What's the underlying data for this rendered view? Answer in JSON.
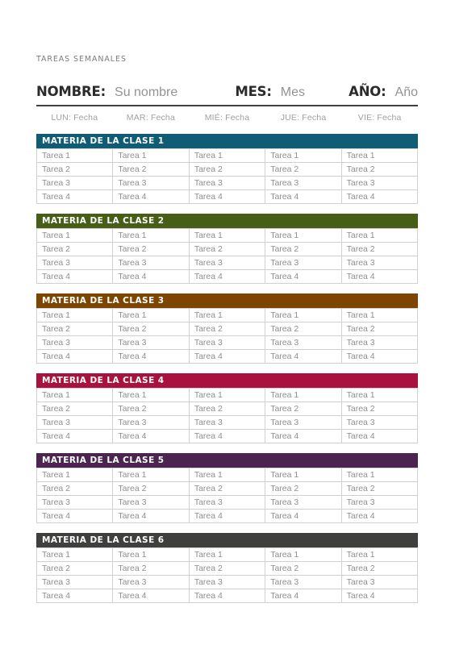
{
  "document": {
    "title": "TAREAS SEMANALES"
  },
  "identity": {
    "name_label": "NOMBRE:",
    "name_value": "Su nombre",
    "month_label": "MES:",
    "month_value": "Mes",
    "year_label": "AÑO:",
    "year_value": "Año"
  },
  "days": [
    {
      "abbr": "LUN:",
      "value": "Fecha"
    },
    {
      "abbr": "MAR:",
      "value": "Fecha"
    },
    {
      "abbr": "MIÉ:",
      "value": "Fecha"
    },
    {
      "abbr": "JUE:",
      "value": "Fecha"
    },
    {
      "abbr": "VIE:",
      "value": "Fecha"
    }
  ],
  "sections": [
    {
      "header": "MATERIA DE LA CLASE 1",
      "color": "#115C75",
      "rows": [
        [
          "Tarea 1",
          "Tarea 1",
          "Tarea 1",
          "Tarea 1",
          "Tarea 1"
        ],
        [
          "Tarea 2",
          "Tarea 2",
          "Tarea 2",
          "Tarea 2",
          "Tarea 2"
        ],
        [
          "Tarea 3",
          "Tarea 3",
          "Tarea 3",
          "Tarea 3",
          "Tarea 3"
        ],
        [
          "Tarea 4",
          "Tarea 4",
          "Tarea 4",
          "Tarea 4",
          "Tarea 4"
        ]
      ]
    },
    {
      "header": "MATERIA DE LA CLASE 2",
      "color": "#465E16",
      "rows": [
        [
          "Tarea 1",
          "Tarea 1",
          "Tarea 1",
          "Tarea 1",
          "Tarea 1"
        ],
        [
          "Tarea 2",
          "Tarea 2",
          "Tarea 2",
          "Tarea 2",
          "Tarea 2"
        ],
        [
          "Tarea 3",
          "Tarea 3",
          "Tarea 3",
          "Tarea 3",
          "Tarea 3"
        ],
        [
          "Tarea 4",
          "Tarea 4",
          "Tarea 4",
          "Tarea 4",
          "Tarea 4"
        ]
      ]
    },
    {
      "header": "MATERIA DE LA CLASE 3",
      "color": "#7D4500",
      "rows": [
        [
          "Tarea 1",
          "Tarea 1",
          "Tarea 1",
          "Tarea 1",
          "Tarea 1"
        ],
        [
          "Tarea 2",
          "Tarea 2",
          "Tarea 2",
          "Tarea 2",
          "Tarea 2"
        ],
        [
          "Tarea 3",
          "Tarea 3",
          "Tarea 3",
          "Tarea 3",
          "Tarea 3"
        ],
        [
          "Tarea 4",
          "Tarea 4",
          "Tarea 4",
          "Tarea 4",
          "Tarea 4"
        ]
      ]
    },
    {
      "header": "MATERIA DE LA CLASE 4",
      "color": "#A9123E",
      "rows": [
        [
          "Tarea 1",
          "Tarea 1",
          "Tarea 1",
          "Tarea 1",
          "Tarea 1"
        ],
        [
          "Tarea 2",
          "Tarea 2",
          "Tarea 2",
          "Tarea 2",
          "Tarea 2"
        ],
        [
          "Tarea 3",
          "Tarea 3",
          "Tarea 3",
          "Tarea 3",
          "Tarea 3"
        ],
        [
          "Tarea 4",
          "Tarea 4",
          "Tarea 4",
          "Tarea 4",
          "Tarea 4"
        ]
      ]
    },
    {
      "header": "MATERIA DE LA CLASE 5",
      "color": "#4C2450",
      "rows": [
        [
          "Tarea 1",
          "Tarea 1",
          "Tarea 1",
          "Tarea 1",
          "Tarea 1"
        ],
        [
          "Tarea 2",
          "Tarea 2",
          "Tarea 2",
          "Tarea 2",
          "Tarea 2"
        ],
        [
          "Tarea 3",
          "Tarea 3",
          "Tarea 3",
          "Tarea 3",
          "Tarea 3"
        ],
        [
          "Tarea 4",
          "Tarea 4",
          "Tarea 4",
          "Tarea 4",
          "Tarea 4"
        ]
      ]
    },
    {
      "header": "MATERIA DE LA CLASE 6",
      "color": "#3F3F3E",
      "rows": [
        [
          "Tarea 1",
          "Tarea 1",
          "Tarea 1",
          "Tarea 1",
          "Tarea 1"
        ],
        [
          "Tarea 2",
          "Tarea 2",
          "Tarea 2",
          "Tarea 2",
          "Tarea 2"
        ],
        [
          "Tarea 3",
          "Tarea 3",
          "Tarea 3",
          "Tarea 3",
          "Tarea 3"
        ],
        [
          "Tarea 4",
          "Tarea 4",
          "Tarea 4",
          "Tarea 4",
          "Tarea 4"
        ]
      ]
    }
  ]
}
